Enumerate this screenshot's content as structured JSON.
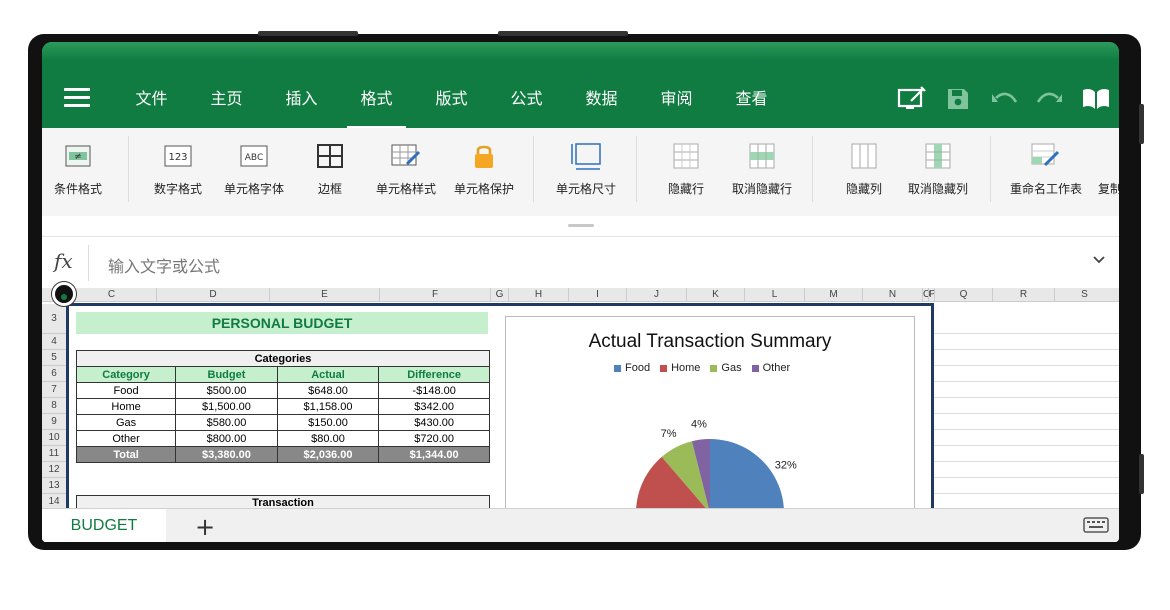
{
  "ribbon": {
    "tabs": [
      "文件",
      "主页",
      "插入",
      "格式",
      "版式",
      "公式",
      "数据",
      "审阅",
      "查看"
    ],
    "active_tab": "格式"
  },
  "toolbar": {
    "conditional_format": "条件格式",
    "number_format": "数字格式",
    "cell_font": "单元格字体",
    "borders": "边框",
    "cell_style": "单元格样式",
    "cell_protect": "单元格保护",
    "cell_size": "单元格尺寸",
    "hide_row": "隐藏行",
    "unhide_row": "取消隐藏行",
    "hide_col": "隐藏列",
    "unhide_col": "取消隐藏列",
    "rename_sheet": "重命名工作表",
    "duplicate": "复制"
  },
  "formula": {
    "fx": "fx",
    "placeholder": "输入文字或公式"
  },
  "columns": [
    "C",
    "D",
    "E",
    "F",
    "G",
    "H",
    "I",
    "J",
    "K",
    "L",
    "M",
    "N",
    "O",
    "P",
    "Q",
    "R",
    "S"
  ],
  "rows": [
    "3",
    "4",
    "5",
    "6",
    "7",
    "8",
    "9",
    "10",
    "11",
    "12",
    "13",
    "14"
  ],
  "budget": {
    "title": "PERSONAL BUDGET",
    "categories_header": "Categories",
    "headers": [
      "Category",
      "Budget",
      "Actual",
      "Difference"
    ],
    "rows": [
      [
        "Food",
        "$500.00",
        "$648.00",
        "-$148.00"
      ],
      [
        "Home",
        "$1,500.00",
        "$1,158.00",
        "$342.00"
      ],
      [
        "Gas",
        "$580.00",
        "$150.00",
        "$430.00"
      ],
      [
        "Other",
        "$800.00",
        "$80.00",
        "$720.00"
      ]
    ],
    "total": [
      "Total",
      "$3,380.00",
      "$2,036.00",
      "$1,344.00"
    ],
    "transaction_header": "Transaction"
  },
  "chart_data": {
    "type": "pie",
    "title": "Actual Transaction Summary",
    "categories": [
      "Food",
      "Home",
      "Gas",
      "Other"
    ],
    "values": [
      648,
      1158,
      150,
      80
    ],
    "colors": [
      "#4f81bd",
      "#c0504d",
      "#9bbb59",
      "#8064a2"
    ],
    "data_labels": [
      "32%",
      "",
      "7%",
      "4%"
    ],
    "legend": "top"
  },
  "sheets": {
    "active": "BUDGET",
    "add": "+"
  },
  "colors": {
    "brand": "#107c41"
  }
}
